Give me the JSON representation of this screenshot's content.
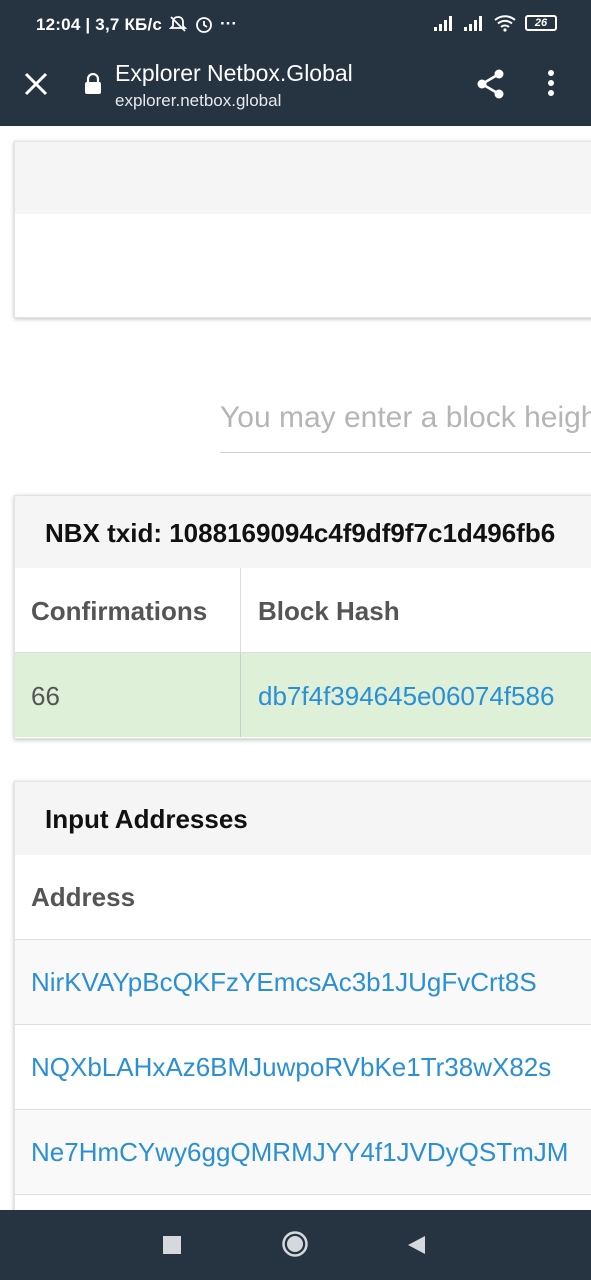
{
  "status_bar": {
    "time": "12:04",
    "speed": "| 3,7 КБ/с",
    "battery": "26",
    "icons": [
      "mute-icon",
      "alarm-icon",
      "more-dots-icon",
      "signal-icon",
      "signal-icon",
      "wifi-icon",
      "battery-icon"
    ]
  },
  "app_bar": {
    "title": "Explorer Netbox.Global",
    "url": "explorer.netbox.global"
  },
  "search": {
    "placeholder": "You may enter a block height, block hash, tx hash or address."
  },
  "tx_panel": {
    "title": "NBX txid: 1088169094c4f9df9f7c1d496fb6",
    "columns": [
      "Confirmations",
      "Block Hash"
    ],
    "row": {
      "confirmations": "66",
      "block_hash": "db7f4f394645e06074f586"
    }
  },
  "inputs_panel": {
    "title": "Input Addresses",
    "column": "Address",
    "addresses": [
      "NirKVAYpBcQKFzYEmcsAc3b1JUgFvCrt8S",
      "NQXbLAHxAz6BMJuwpoRVbKe1Tr38wX82s",
      "Ne7HmCYwy6ggQMRMJYY4f1JVDyQSTmJM"
    ]
  },
  "colors": {
    "bar": "#263340",
    "link": "#2b8fd6",
    "confirmed_row": "#dff0d8"
  }
}
